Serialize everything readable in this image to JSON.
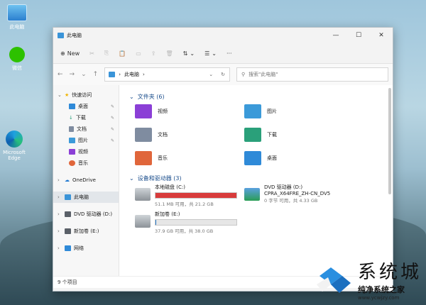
{
  "desktop": {
    "icons": [
      {
        "label": "此电脑",
        "icon": "pc-icon"
      },
      {
        "label": "微信",
        "icon": "wechat-icon"
      },
      {
        "label": "Microsoft Edge",
        "icon": "edge-icon"
      }
    ]
  },
  "window": {
    "title": "此电脑",
    "controls": [
      "—",
      "☐",
      "✕"
    ]
  },
  "toolbar": {
    "new_label": "New",
    "sort_icon": "sort-icon",
    "view_icon": "view-icon",
    "more": "···"
  },
  "address": {
    "path": "此电脑",
    "separator": "›",
    "search_placeholder": "搜索\"此电脑\""
  },
  "sidebar": {
    "quick_access": "快速访问",
    "items": [
      {
        "label": "桌面",
        "color": "#2f8ad8"
      },
      {
        "label": "下载",
        "color": "#2aa07a"
      },
      {
        "label": "文档",
        "color": "#7f8ca0"
      },
      {
        "label": "图片",
        "color": "#3b9ad9"
      },
      {
        "label": "视频",
        "color": "#8b3fd6"
      },
      {
        "label": "音乐",
        "color": "#e0663b"
      }
    ],
    "onedrive": "OneDrive",
    "this_pc": "此电脑",
    "dvd": "DVD 驱动器 (D:)",
    "new_volume": "新加卷 (E:)",
    "network": "网络"
  },
  "content": {
    "folders_header": "文件夹 (6)",
    "folders": [
      {
        "name": "视频",
        "color": "#8b3fd6",
        "icon": "video-folder-icon"
      },
      {
        "name": "图片",
        "color": "#3b9ad9",
        "icon": "pictures-folder-icon"
      },
      {
        "name": "文档",
        "color": "#7f8ca0",
        "icon": "documents-folder-icon"
      },
      {
        "name": "下载",
        "color": "#2aa07a",
        "icon": "downloads-folder-icon"
      },
      {
        "name": "音乐",
        "color": "#e0663b",
        "icon": "music-folder-icon"
      },
      {
        "name": "桌面",
        "color": "#2f8ad8",
        "icon": "desktop-folder-icon"
      }
    ],
    "drives_header": "设备和驱动器 (3)",
    "drives": [
      {
        "name": "本地磁盘 (C:)",
        "sub": "51.1 MB 可用，共 21.2 GB",
        "used_fraction": 0.998,
        "color": "#d83b3b",
        "icon": "disk-icon"
      },
      {
        "name": "DVD 驱动器 (D:)\nCPRA_X64FRE_ZH-CN_DV5",
        "sub": "0 字节 可用，共 4.33 GB",
        "used_fraction": null,
        "color": "",
        "icon": "dvd-icon"
      },
      {
        "name": "新加卷 (E:)",
        "sub": "37.9 GB 可用，共 38.0 GB",
        "used_fraction": 0.003,
        "color": "#2a7fd0",
        "icon": "disk-icon"
      }
    ]
  },
  "status": {
    "count": "9 个项目"
  },
  "watermark": {
    "text": "系统城",
    "brand": "纯净系统之家",
    "url": "www.ycwjzy.com"
  }
}
